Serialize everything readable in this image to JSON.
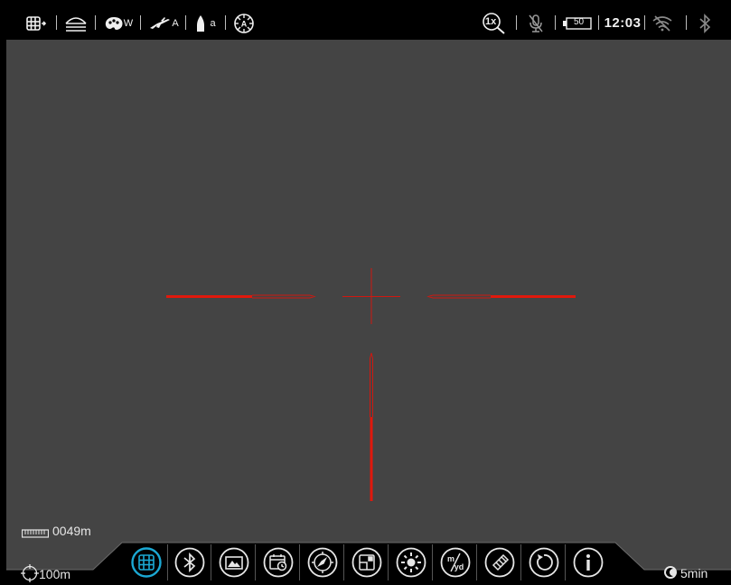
{
  "topbar": {
    "wind_mode": "W",
    "rifle_mode": "A",
    "ammo_mode": "a",
    "zoom_label": "1x",
    "battery_label": "50",
    "time": "12:03"
  },
  "bottom_left": {
    "rangefinder_value": "0049m",
    "zero_distance": "100m"
  },
  "bottom_right": {
    "standby_timer": "5min"
  },
  "menu": {
    "selected_index": 0,
    "items": [
      {
        "icon": "reticle-menu-icon"
      },
      {
        "icon": "bluetooth-icon"
      },
      {
        "icon": "image-mode-icon"
      },
      {
        "icon": "date-time-icon"
      },
      {
        "icon": "compass-icon"
      },
      {
        "icon": "pip-icon"
      },
      {
        "icon": "brightness-icon"
      },
      {
        "icon": "units-icon",
        "label": "m/yd"
      },
      {
        "icon": "calibration-icon"
      },
      {
        "icon": "reset-icon"
      },
      {
        "icon": "info-icon"
      }
    ]
  },
  "colors": {
    "screen_bg": "#444444",
    "reticle_red": "#e0180c",
    "selected_accent": "#1ba9d4",
    "bar_bg": "#000000"
  }
}
